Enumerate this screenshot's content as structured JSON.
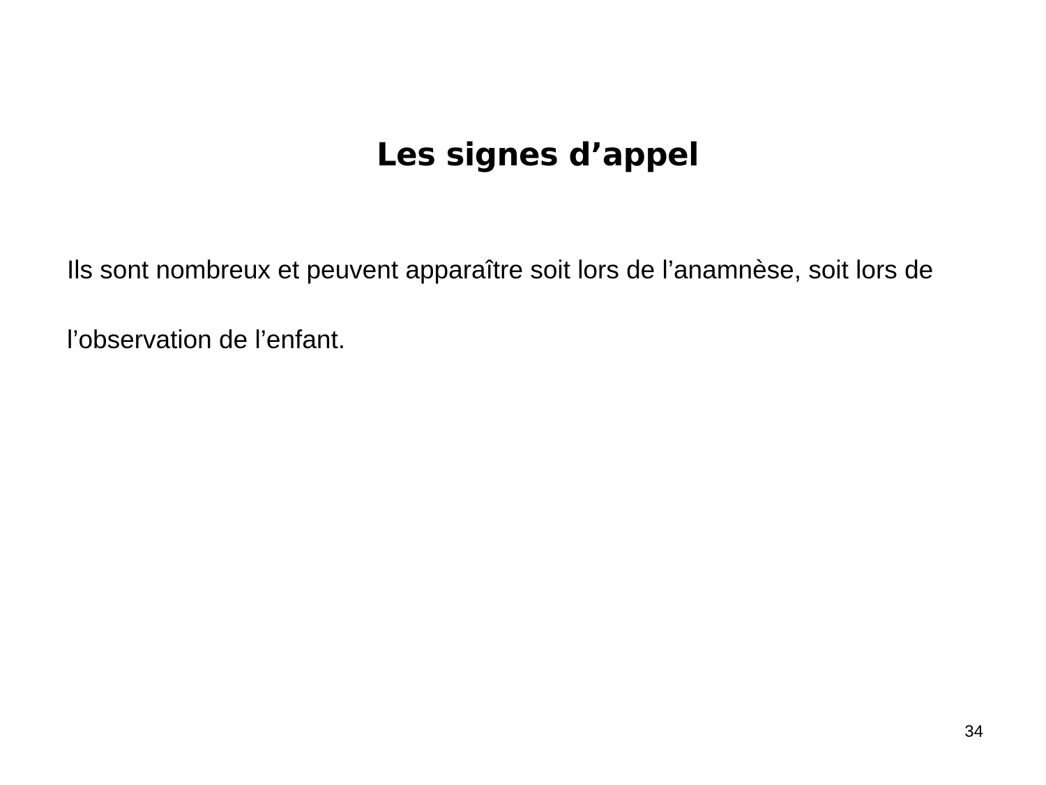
{
  "slide": {
    "title": "Les signes d’appel",
    "body": "Ils sont nombreux et peuvent apparaître soit lors de l’anamnèse, soit lors de l’observation de l’enfant.",
    "page_number": "34"
  },
  "colors": {
    "background": "#ffffff",
    "text": "#000000"
  }
}
